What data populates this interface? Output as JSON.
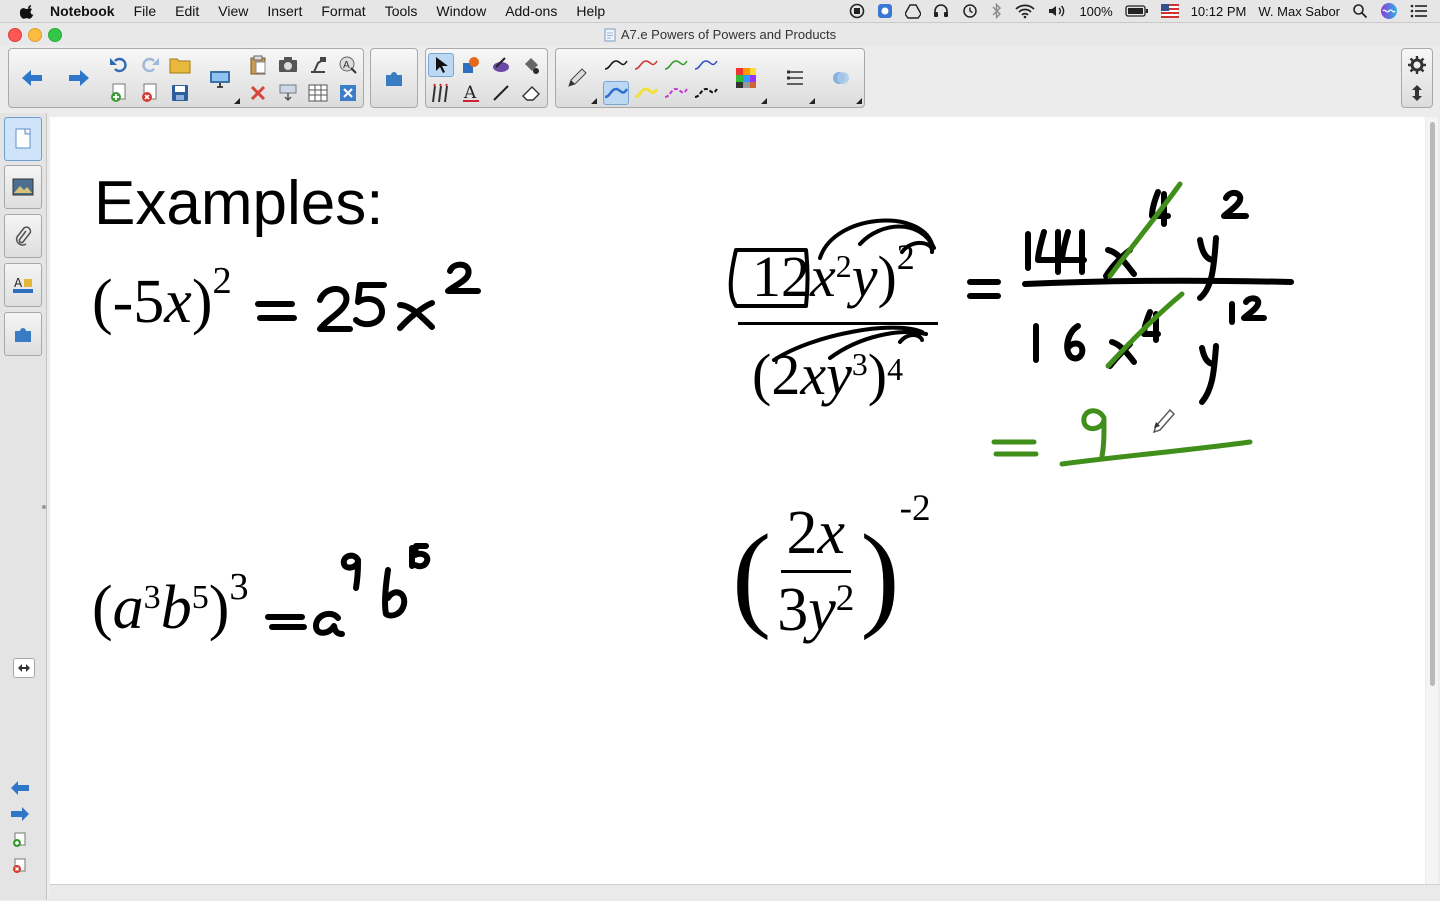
{
  "menubar": {
    "app_name": "Notebook",
    "items": [
      "File",
      "Edit",
      "View",
      "Insert",
      "Format",
      "Tools",
      "Window",
      "Add-ons",
      "Help"
    ],
    "battery": "100%",
    "time": "10:12 PM",
    "user": "W. Max Sabor"
  },
  "window": {
    "title": "A7.e Powers of Powers and Products"
  },
  "page": {
    "heading": "Examples:",
    "problems": {
      "p1": {
        "base": "(-5",
        "var": "x",
        "close": ")",
        "exp": "2"
      },
      "p2": {
        "open": "(",
        "a": "a",
        "a_exp": "3",
        "b": "b",
        "b_exp": "5",
        "close": ")",
        "exp": "3"
      },
      "p3": {
        "coef": "12",
        "x": "x",
        "x_exp": "2",
        "y": "y",
        "num_exp": "2",
        "den_coef": "(2",
        "den_x": "x",
        "den_y": "y",
        "den_y_exp": "3",
        "den_close": ")",
        "den_exp": "4"
      },
      "p4": {
        "num_coef": "2",
        "num_var": "x",
        "den_coef": "3",
        "den_var": "y",
        "den_exp": "2",
        "exp": "-2"
      }
    },
    "handwriting": {
      "p1_answer": "= 25x²",
      "p2_answer": "= a⁹ b¹⁵",
      "p3_work": "= 144 x⁴ y² / 16 x⁴ y¹² = 9 / ___"
    }
  },
  "colors": {
    "ink": "#000000",
    "green_ink": "#3f8f1a",
    "selected": "#bcd8f3",
    "canvas": "#ffffff"
  }
}
